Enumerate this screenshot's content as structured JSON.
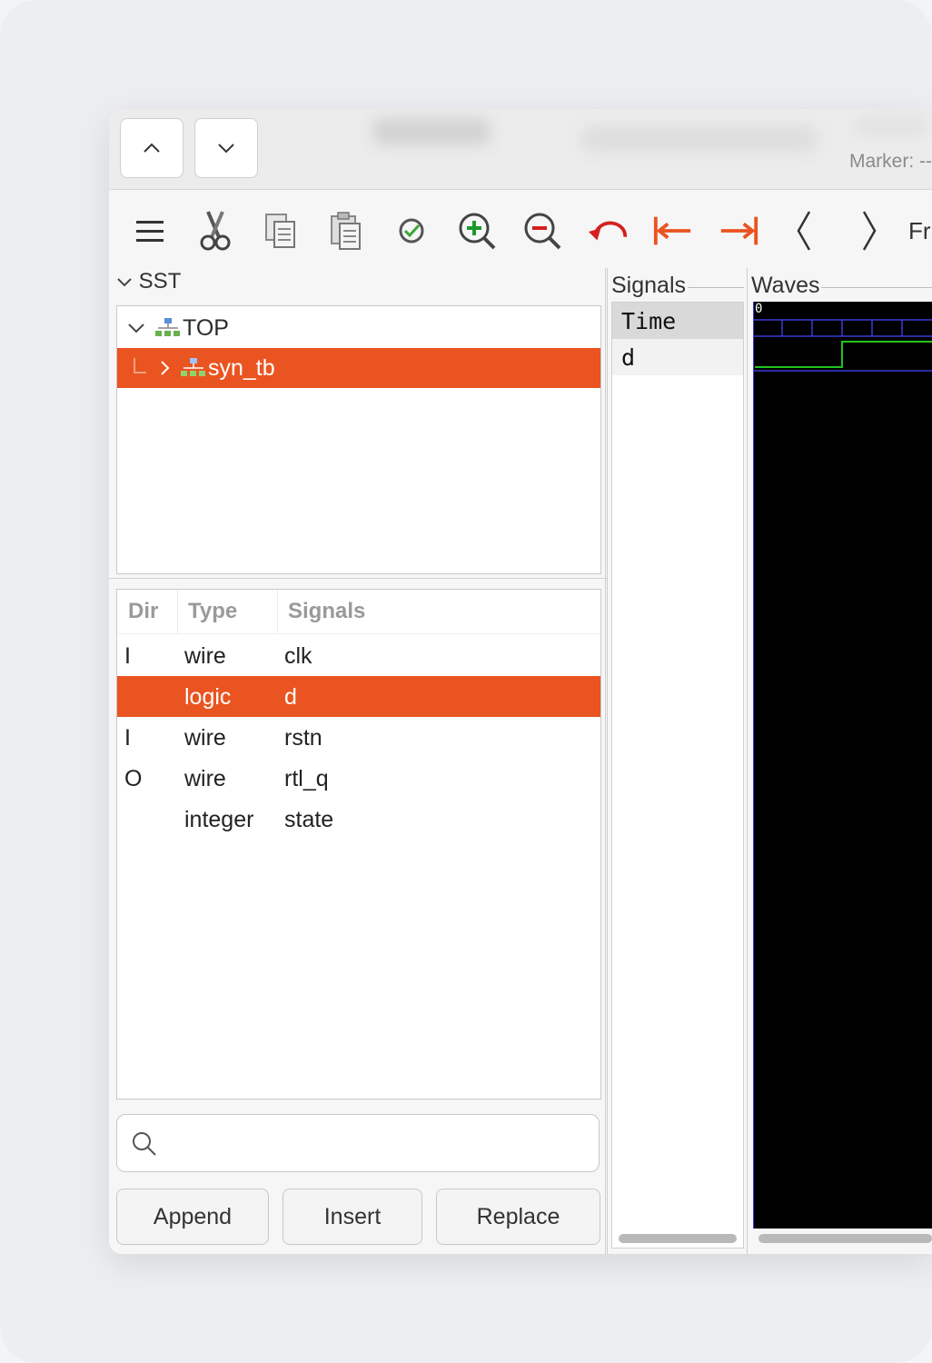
{
  "titlebar": {
    "marker_label": "Marker: --"
  },
  "toolbar": {
    "items": [
      "menu",
      "cut",
      "copy",
      "paste",
      "select-all",
      "zoom-in",
      "zoom-out",
      "undo",
      "zoom-start",
      "zoom-end",
      "previous",
      "next"
    ],
    "trailing_text": "Fr"
  },
  "sst": {
    "label": "SST",
    "tree": [
      {
        "label": "TOP",
        "expanded": true,
        "selected": false
      },
      {
        "label": "syn_tb",
        "expanded": false,
        "selected": true
      }
    ]
  },
  "signals_table": {
    "headers": {
      "dir": "Dir",
      "type": "Type",
      "signals": "Signals"
    },
    "rows": [
      {
        "dir": "I",
        "type": "wire",
        "name": "clk",
        "selected": false
      },
      {
        "dir": "",
        "type": "logic",
        "name": "d",
        "selected": true
      },
      {
        "dir": "I",
        "type": "wire",
        "name": "rstn",
        "selected": false
      },
      {
        "dir": "O",
        "type": "wire",
        "name": "rtl_q",
        "selected": false
      },
      {
        "dir": "",
        "type": "integer",
        "name": "state",
        "selected": false
      }
    ]
  },
  "search": {
    "placeholder": ""
  },
  "actions": {
    "append": "Append",
    "insert": "Insert",
    "replace": "Replace"
  },
  "signals_panel": {
    "title": "Signals",
    "items": [
      "Time",
      "d"
    ]
  },
  "waves_panel": {
    "title": "Waves",
    "time_start_label": "0"
  },
  "colors": {
    "accent": "#e95420",
    "wave_green": "#22c41a",
    "wave_grid": "#3b3bd6"
  }
}
